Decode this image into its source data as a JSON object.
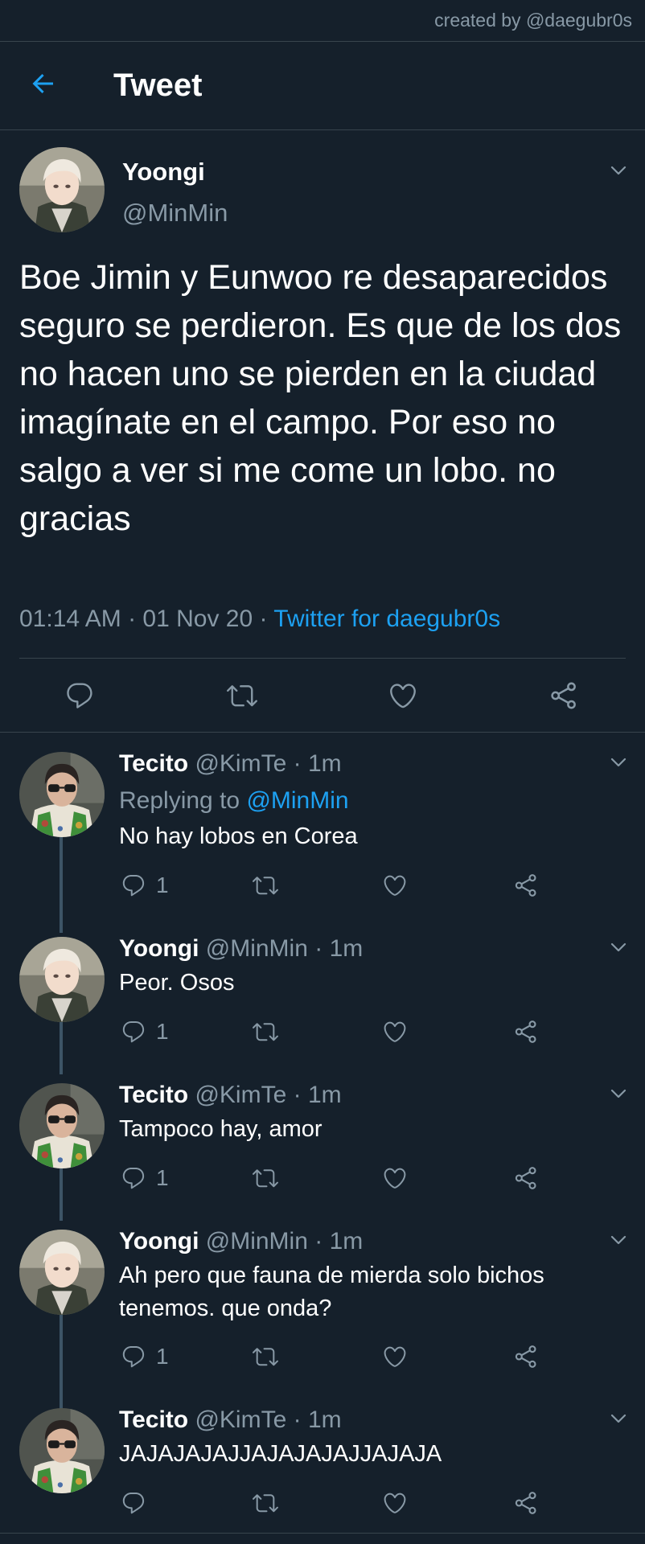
{
  "watermark": "created by @daegubr0s",
  "header": {
    "title": "Tweet"
  },
  "main_tweet": {
    "name": "Yoongi",
    "handle": "@MinMin",
    "text": "Boe Jimin y Eunwoo re desaparecidos seguro se perdieron. Es que de los dos no hacen uno se pierden en la ciudad imagínate en el campo. Por eso no salgo a ver si me come un lobo. no gracias",
    "timestamp": "01:14 AM · 01 Nov 20 · ",
    "source": "Twitter for daegubr0s"
  },
  "replies": [
    {
      "name": "Tecito",
      "handle": "@KimTe",
      "dot": "·",
      "time": "1m",
      "replying_prefix": "Replying to ",
      "replying_mention": "@MinMin",
      "text": "No hay lobos en Corea",
      "reply_count": "1"
    },
    {
      "name": "Yoongi",
      "handle": "@MinMin",
      "dot": "·",
      "time": "1m",
      "text": "Peor. Osos",
      "reply_count": "1"
    },
    {
      "name": "Tecito",
      "handle": "@KimTe",
      "dot": "·",
      "time": "1m",
      "text": "Tampoco hay, amor",
      "reply_count": "1"
    },
    {
      "name": "Yoongi",
      "handle": "@MinMin",
      "dot": "·",
      "time": "1m",
      "text": "Ah pero que fauna de mierda solo bichos tenemos. que onda?",
      "reply_count": "1"
    },
    {
      "name": "Tecito",
      "handle": "@KimTe",
      "dot": "·",
      "time": "1m",
      "text": "JAJAJAJAJJAJAJAJAJJAJAJA",
      "reply_count": ""
    }
  ],
  "colors": {
    "background": "#15202b",
    "divider": "#38444d",
    "secondary_text": "#8899a6",
    "accent": "#1da1f2"
  }
}
